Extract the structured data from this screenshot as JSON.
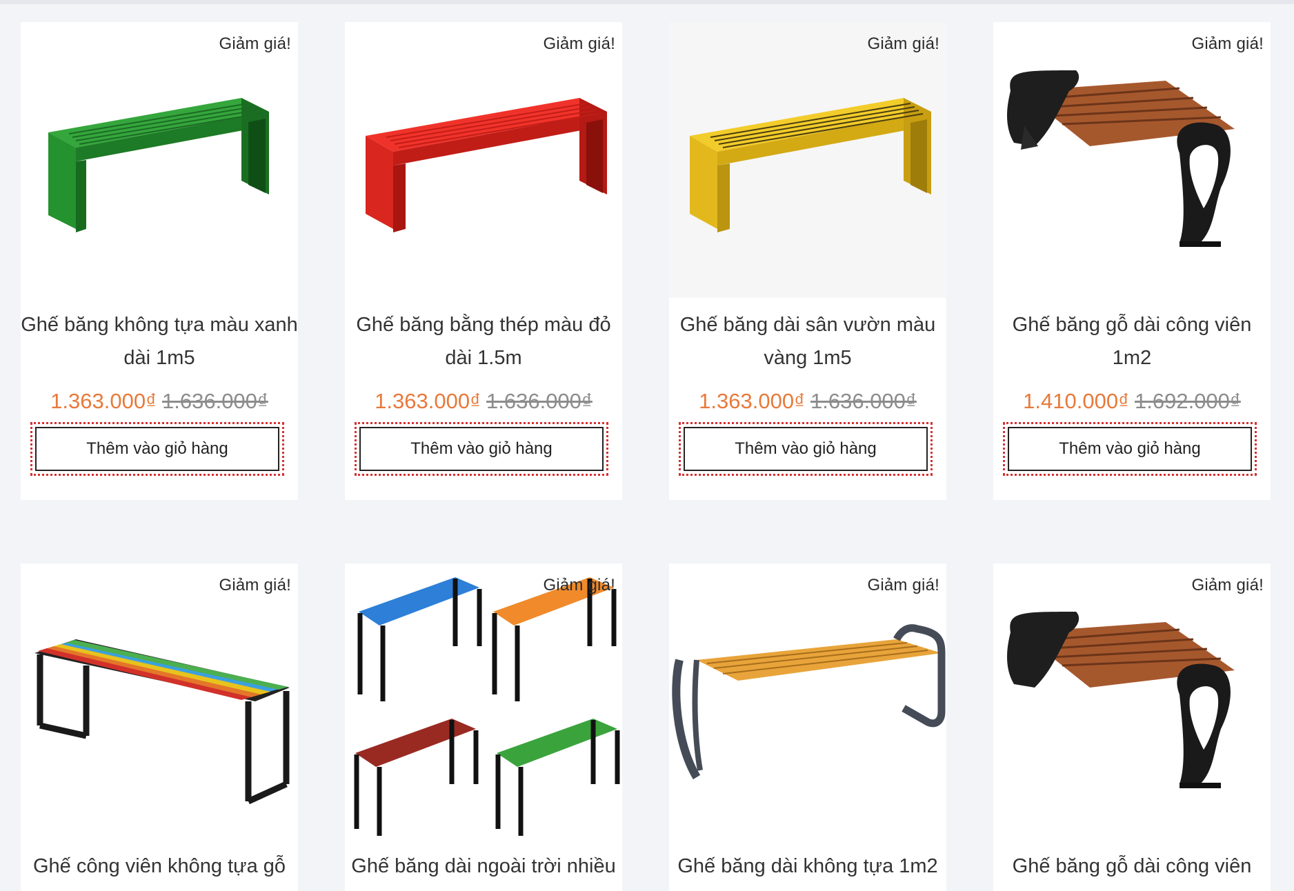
{
  "sale_badge": "Giảm giá!",
  "add_to_cart": "Thêm vào giỏ hàng",
  "products": [
    {
      "name": "Ghế băng không tựa màu xanh dài 1m5",
      "price": "1.363.000₫",
      "old_price": "1.636.000₫",
      "color": "#1f8a2a"
    },
    {
      "name": "Ghế băng bằng thép màu đỏ dài 1.5m",
      "price": "1.363.000₫",
      "old_price": "1.636.000₫",
      "color": "#e12a22"
    },
    {
      "name": "Ghế băng dài sân vườn màu vàng 1m5",
      "price": "1.363.000₫",
      "old_price": "1.636.000₫",
      "color": "#e8bf1c"
    },
    {
      "name": "Ghế băng gỗ dài công viên 1m2",
      "price": "1.410.000₫",
      "old_price": "1.692.000₫",
      "color": "#a0562c"
    },
    {
      "name": "Ghế công viên không tựa gỗ"
    },
    {
      "name": "Ghế băng dài ngoài trời nhiều"
    },
    {
      "name": "Ghế băng dài không tựa 1m2"
    },
    {
      "name": "Ghế băng gỗ dài công viên"
    }
  ]
}
